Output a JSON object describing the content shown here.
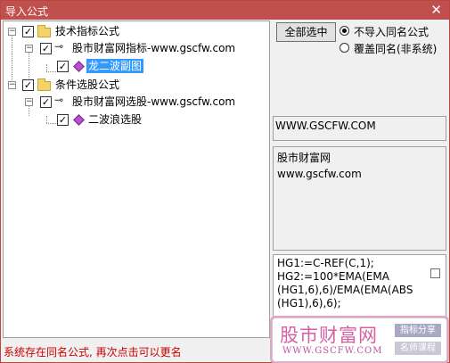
{
  "window": {
    "title": "导入公式",
    "close_glyph": "✕"
  },
  "tree": {
    "nodes": [
      {
        "label": "技术指标公式",
        "checked": true,
        "type": "folder"
      },
      {
        "label": "股市财富网指标-www.gscfw.com",
        "checked": true,
        "type": "key"
      },
      {
        "label": "龙二波副图",
        "checked": true,
        "type": "formula",
        "selected": true
      },
      {
        "label": "条件选股公式",
        "checked": true,
        "type": "folder"
      },
      {
        "label": "股市财富网选股-www.gscfw.com",
        "checked": true,
        "type": "key"
      },
      {
        "label": "二波浪选股",
        "checked": true,
        "type": "formula",
        "selected": false
      }
    ]
  },
  "options": {
    "select_all_label": "全部选中",
    "radio1_label": "不导入同名公式",
    "radio2_label": "覆盖同名(非系统)",
    "radio1_selected": true
  },
  "info": {
    "site": "WWW.GSCFW.COM",
    "desc_line1": "股市财富网",
    "desc_line2": "www.gscfw.com"
  },
  "code": {
    "lines": [
      "HG1:=C-REF(C,1);",
      "HG2:=100*EMA(EMA",
      "(HG1,6),6)/EMA(EMA(ABS",
      "(HG1),6),6);"
    ]
  },
  "watermark": {
    "main": "股市财富网",
    "sub": "WWW.GSCFW.COM",
    "tag1": "指标分享",
    "tag2": "名师课程"
  },
  "status": {
    "message": "系统存在同名公式, 再次点击可以更名"
  },
  "colors": {
    "titlebar": "#c0504d",
    "selection": "#3399ff",
    "status_text": "#cc0000",
    "watermark": "#d660a4"
  }
}
